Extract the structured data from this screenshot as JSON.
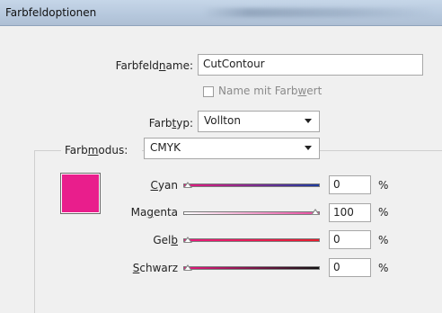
{
  "window": {
    "title": "Farbfeldoptionen"
  },
  "fields": {
    "name_label_pre": "Farbfeld",
    "name_label_u": "n",
    "name_label_post": "ame:",
    "name_value": "CutContour",
    "checkbox_pre": "Name mit Farb",
    "checkbox_u": "w",
    "checkbox_post": "ert",
    "checkbox_checked": false,
    "type_label_pre": "Farb",
    "type_label_u": "t",
    "type_label_post": "yp:",
    "type_value": "Vollton",
    "mode_label_pre": "Farb",
    "mode_label_u": "m",
    "mode_label_post": "odus:",
    "mode_value": "CMYK"
  },
  "swatch_color": "#e91e8c",
  "sliders": [
    {
      "label_u": "C",
      "label_post": "yan",
      "value": "0",
      "unit": "%",
      "level": 0,
      "gradient": [
        "#e8197f",
        "#1c3a9e"
      ]
    },
    {
      "label_pre": "Ma",
      "label_u": "g",
      "label_post": "enta",
      "value": "100",
      "unit": "%",
      "level": 100,
      "gradient": [
        "#ffffff",
        "#e84aa0"
      ]
    },
    {
      "label_pre": "Gel",
      "label_u": "b",
      "label_post": "",
      "value": "0",
      "unit": "%",
      "level": 0,
      "gradient": [
        "#e8197f",
        "#e61c2c"
      ]
    },
    {
      "label_u": "S",
      "label_post": "chwarz",
      "value": "0",
      "unit": "%",
      "level": 0,
      "gradient": [
        "#e8197f",
        "#111111"
      ]
    }
  ]
}
